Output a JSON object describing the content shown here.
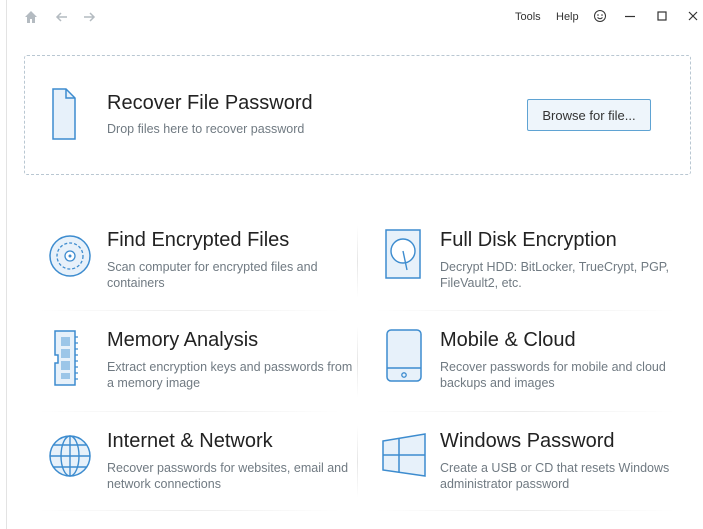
{
  "toolbar": {
    "home_icon": "home-icon",
    "back_icon": "arrow-left-icon",
    "forward_icon": "arrow-right-icon",
    "tools_label": "Tools",
    "help_label": "Help",
    "feedback_icon": "smiley-icon",
    "minimize_icon": "minimize-icon",
    "maximize_icon": "maximize-icon",
    "close_icon": "close-icon"
  },
  "dropzone": {
    "title": "Recover File Password",
    "subtitle": "Drop files here to recover password",
    "browse_label": "Browse for file...",
    "icon": "document-icon"
  },
  "tiles": [
    {
      "title": "Find Encrypted Files",
      "desc": "Scan computer for encrypted files and containers",
      "icon": "disk-scan-icon"
    },
    {
      "title": "Full Disk Encryption",
      "desc": "Decrypt HDD: BitLocker, TrueCrypt, PGP, FileVault2, etc.",
      "icon": "hard-drive-icon"
    },
    {
      "title": "Memory Analysis",
      "desc": "Extract encryption keys and passwords from a memory image",
      "icon": "memory-module-icon"
    },
    {
      "title": "Mobile & Cloud",
      "desc": "Recover passwords for mobile and cloud backups and images",
      "icon": "mobile-phone-icon"
    },
    {
      "title": "Internet & Network",
      "desc": "Recover passwords for websites, email and network connections",
      "icon": "globe-icon"
    },
    {
      "title": "Windows Password",
      "desc": "Create a USB or CD that resets Windows administrator password",
      "icon": "windows-logo-icon"
    }
  ],
  "colors": {
    "accent": "#3d8ccf",
    "icon_fill": "#e7f1fa",
    "muted_text": "#707a82",
    "nav_icon": "#b4bbc1"
  }
}
